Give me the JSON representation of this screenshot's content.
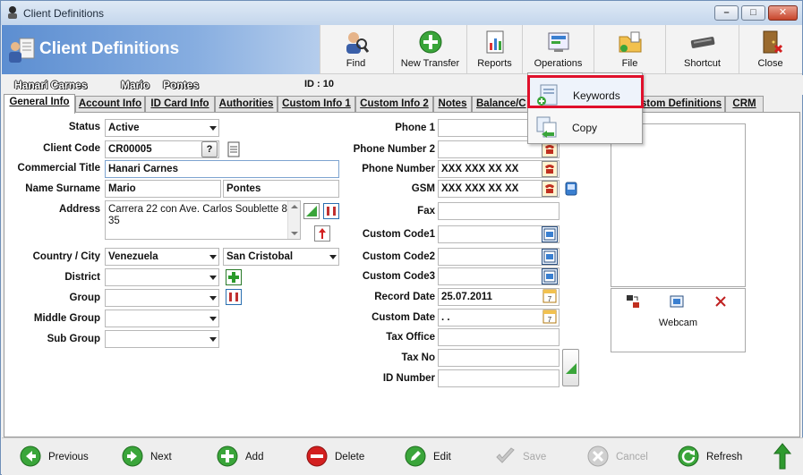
{
  "window": {
    "title": "Client Definitions"
  },
  "header": {
    "title": "Client Definitions"
  },
  "toolbar": {
    "find": "Find",
    "new_transfer": "New Transfer",
    "reports": "Reports",
    "operations": "Operations",
    "file": "File",
    "shortcut": "Shortcut",
    "close": "Close"
  },
  "client_strip": {
    "commercial_title": "Hanari Carnes",
    "name": "Mario",
    "surname": "Pontes",
    "id_label": "ID : 10"
  },
  "tabs": [
    "General Info",
    "Account Info",
    "ID Card Info",
    "Authorities",
    "Custom Info 1",
    "Custom Info 2",
    "Notes",
    "Balance/C",
    "stom Definitions",
    "CRM"
  ],
  "popup_menu": {
    "items": [
      {
        "label": "Keywords"
      },
      {
        "label": "Copy"
      }
    ]
  },
  "form": {
    "status": {
      "label": "Status",
      "value": "Active"
    },
    "client_code": {
      "label": "Client Code",
      "value": "CR00005",
      "help": "?"
    },
    "commercial_title": {
      "label": "Commercial Title",
      "value": "Hanari Carnes"
    },
    "name_surname": {
      "label": "Name Surname",
      "name": "Mario",
      "surname": "Pontes"
    },
    "address": {
      "label": "Address",
      "value": "Carrera 22 con Ave. Carlos Soublette 8-35"
    },
    "country_city": {
      "label": "Country / City",
      "country": "Venezuela",
      "city": "San Cristobal"
    },
    "district": {
      "label": "District",
      "value": ""
    },
    "group": {
      "label": "Group",
      "value": ""
    },
    "middle_group": {
      "label": "Middle Group",
      "value": ""
    },
    "sub_group": {
      "label": "Sub Group",
      "value": ""
    },
    "phone1": {
      "label": "Phone 1",
      "value": ""
    },
    "phone_number2": {
      "label": "Phone Number 2",
      "value": ""
    },
    "phone_number": {
      "label": "Phone Number",
      "value": "XXX XXX XX XX"
    },
    "gsm": {
      "label": "GSM",
      "value": "XXX XXX XX XX"
    },
    "fax": {
      "label": "Fax",
      "value": ""
    },
    "custom_code1": {
      "label": "Custom Code1",
      "value": ""
    },
    "custom_code2": {
      "label": "Custom Code2",
      "value": ""
    },
    "custom_code3": {
      "label": "Custom Code3",
      "value": ""
    },
    "record_date": {
      "label": "Record Date",
      "value": "25.07.2011"
    },
    "custom_date": {
      "label": "Custom Date",
      "value": " .  ."
    },
    "tax_office": {
      "label": "Tax Office",
      "value": ""
    },
    "tax_no": {
      "label": "Tax No",
      "value": ""
    },
    "id_number": {
      "label": "ID Number",
      "value": ""
    }
  },
  "photo": {
    "webcam_label": "Webcam"
  },
  "bottom_nav": {
    "previous": "Previous",
    "next": "Next",
    "add": "Add",
    "delete": "Delete",
    "edit": "Edit",
    "save": "Save",
    "cancel": "Cancel",
    "refresh": "Refresh"
  },
  "colors": {
    "header_gradient_start": "#5c8ed1",
    "highlight_border": "#e0102b",
    "nav_green": "#3aa53a",
    "delete_red": "#d32020"
  }
}
